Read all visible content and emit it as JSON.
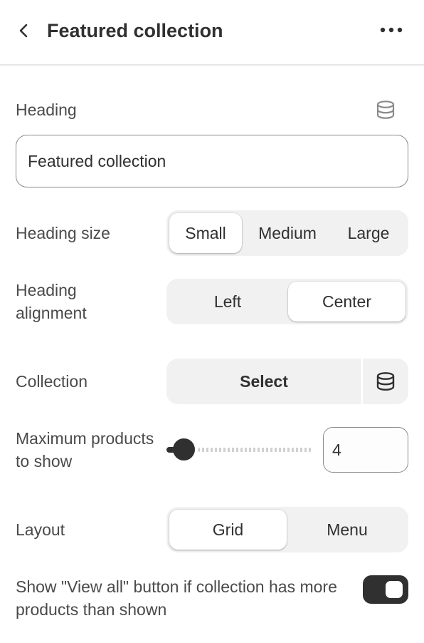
{
  "header": {
    "title": "Featured collection",
    "back_icon": "chevron-left-icon",
    "more_icon": "ellipsis-horizontal-icon"
  },
  "heading": {
    "label": "Heading",
    "value": "Featured collection",
    "dynamic_source_icon": "database-icon"
  },
  "heading_size": {
    "label": "Heading size",
    "options": [
      "Small",
      "Medium",
      "Large"
    ],
    "selected": "Small"
  },
  "heading_alignment": {
    "label": "Heading alignment",
    "options": [
      "Left",
      "Center"
    ],
    "selected": "Center"
  },
  "collection": {
    "label": "Collection",
    "select_label": "Select",
    "dynamic_source_icon": "database-icon"
  },
  "max_products": {
    "label": "Maximum products to show",
    "value": "4",
    "slider_fraction": 0.12
  },
  "layout": {
    "label": "Layout",
    "options": [
      "Grid",
      "Menu"
    ],
    "selected": "Grid"
  },
  "view_all": {
    "label": "Show \"View all\" button if collection has more products than shown",
    "enabled": true
  },
  "colors": {
    "text": "#303030",
    "label": "#4a4a4a",
    "segment_bg": "#f1f1f1",
    "border": "#8a8a8a",
    "toggle_on": "#303030"
  }
}
